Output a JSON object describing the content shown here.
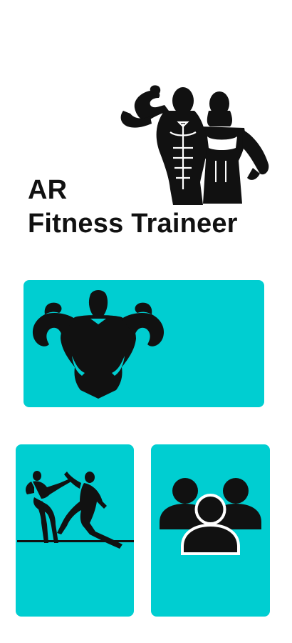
{
  "app": {
    "title_line1": "AR",
    "title_line2": "Fitness Traineer"
  },
  "hero": {
    "icon": "bodybuilder-couple-icon"
  },
  "tiles": [
    {
      "id": "workout",
      "icon": "muscle-flex-icon"
    },
    {
      "id": "combat",
      "icon": "martial-arts-icon"
    },
    {
      "id": "community",
      "icon": "group-people-icon"
    }
  ],
  "colors": {
    "accent": "#00CED1",
    "text": "#111111",
    "background": "#FFFFFF",
    "icon": "#111111"
  }
}
